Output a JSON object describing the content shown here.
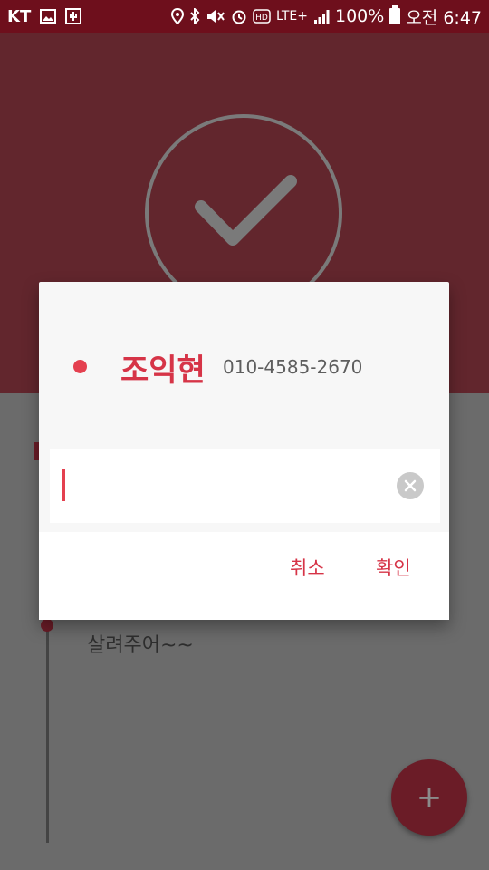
{
  "status_bar": {
    "carrier": "KT",
    "lte": "LTE+",
    "battery": "100%",
    "time": "오전 6:47",
    "icons": [
      "image-icon",
      "usb-icon",
      "location-icon",
      "bluetooth-icon",
      "mute-icon",
      "alarm-icon",
      "hd-icon",
      "signal-icon",
      "battery-icon"
    ]
  },
  "header": {
    "icon": "check-circle-icon"
  },
  "background": {
    "message": "살려주어~~"
  },
  "dialog": {
    "contact_name": "조익현",
    "contact_phone": "010-4585-2670",
    "input_value": "",
    "cancel_label": "취소",
    "confirm_label": "확인"
  },
  "fab": {
    "label": "+"
  },
  "colors": {
    "accent": "#d63447",
    "status_bar": "#6e0f1c",
    "header_dimmed": "#62262d"
  }
}
